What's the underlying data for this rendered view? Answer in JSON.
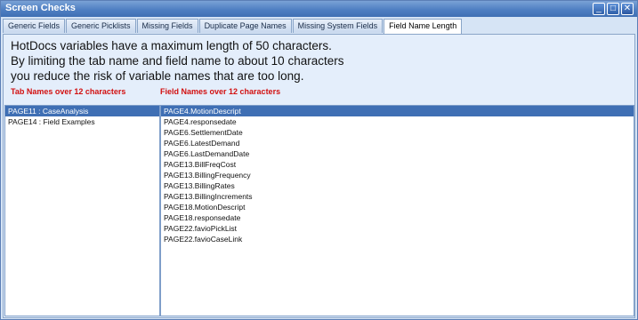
{
  "window": {
    "title": "Screen Checks",
    "buttons": {
      "minimize": "_",
      "maximize": "□",
      "close": "✕"
    }
  },
  "tabs": [
    {
      "label": "Generic Fields"
    },
    {
      "label": "Generic Picklists"
    },
    {
      "label": "Missing Fields"
    },
    {
      "label": "Duplicate Page Names"
    },
    {
      "label": "Missing System Fields"
    },
    {
      "label": "Field Name Length"
    }
  ],
  "active_tab": "Field Name Length",
  "info": {
    "line1": "HotDocs variables have a maximum length of 50 characters.",
    "line2": "By limiting the tab name and field name to about 10 characters",
    "line3": "you reduce the risk of variable names that are too long."
  },
  "headers": {
    "tabs": "Tab Names over 12 characters",
    "fields": "Field Names over 12 characters"
  },
  "tab_list": [
    "PAGE11 : CaseAnalysis",
    "PAGE14 : Field Examples"
  ],
  "field_list": [
    "PAGE4.MotionDescript",
    "PAGE4.responsedate",
    "PAGE6.SettlementDate",
    "PAGE6.LatestDemand",
    "PAGE6.LastDemandDate",
    "PAGE13.BillFreqCost",
    "PAGE13.BillingFrequency",
    "PAGE13.BillingRates",
    "PAGE13.BillingIncrements",
    "PAGE18.MotionDescript",
    "PAGE18.responsedate",
    "PAGE22.favioPickList",
    "PAGE22.favioCaseLink"
  ],
  "colors": {
    "accent": "#3f6fb4",
    "header_red": "#d21010",
    "panel_bg": "#e4eefb"
  }
}
